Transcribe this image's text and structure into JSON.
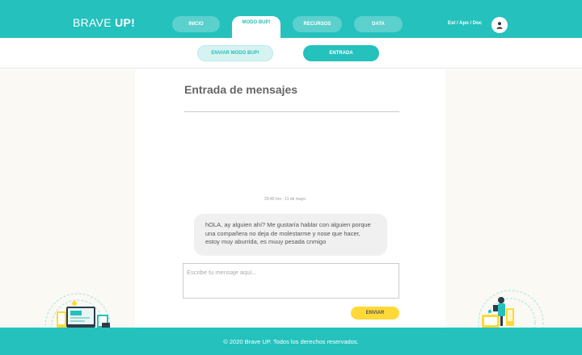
{
  "header": {
    "logo_main": "BRAVE ",
    "logo_bold": "UP!",
    "nav": [
      {
        "label": "INICIO"
      },
      {
        "label": "MODO BUP!"
      },
      {
        "label": "RECURSOS"
      },
      {
        "label": "DATA"
      }
    ],
    "roles": "Est / Apo / Doc",
    "avatar_icon": "user-icon"
  },
  "subnav": {
    "send_label": "ENVIAR MODO BUP!",
    "inbox_label": "ENTRADA"
  },
  "inbox": {
    "title": "Entrada de mensajes",
    "messages": [
      {
        "timestamp": "20:45 hrs - 11 de mayo",
        "text": "hOLA, ay alguien ahí? Me gustaría hablar con alguien porque una compañera no deja de molestarme y nose que hacer, estoy muy aburrida, es muuy pesada cnmigo"
      }
    ],
    "input_placeholder": "Escribe tu mensaje aquí...",
    "send_button": "ENVIAR"
  },
  "footer": {
    "copyright": "© 2020 Brave UP. Todos los derechos reservados."
  },
  "colors": {
    "brand": "#24c1bd",
    "accent": "#ffd938",
    "side_bg": "#faf9f4"
  }
}
